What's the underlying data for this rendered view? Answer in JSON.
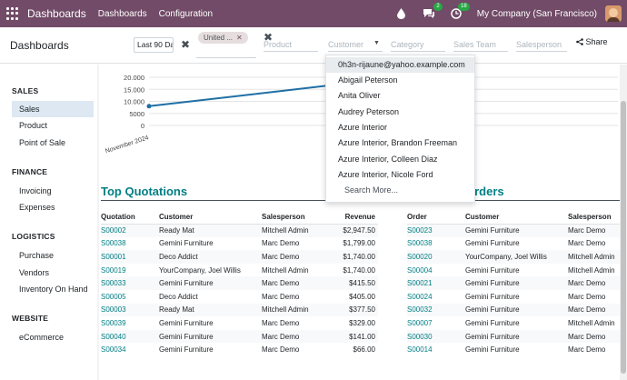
{
  "topbar": {
    "app_title": "Dashboards",
    "menu": [
      "Dashboards",
      "Configuration"
    ],
    "chat_badge": "2",
    "activity_badge": "18",
    "company": "My Company (San Francisco)",
    "colors": {
      "bar": "#714b67",
      "chat_badge": "#28a745",
      "activity_badge": "#28a745"
    }
  },
  "control": {
    "page_title": "Dashboards",
    "period": "Last 90 Days",
    "facet": "United ...",
    "fields": {
      "product": "Product",
      "customer": "Customer",
      "category": "Category",
      "sales_team": "Sales Team",
      "salesperson": "Salesperson"
    },
    "share_label": "Share"
  },
  "sidebar": {
    "sections": [
      {
        "title": "SALES",
        "items": [
          "Sales",
          "Product",
          "Point of Sale"
        ]
      },
      {
        "title": "FINANCE",
        "items": [
          "Invoicing",
          "Expenses"
        ]
      },
      {
        "title": "LOGISTICS",
        "items": [
          "Purchase",
          "Vendors",
          "Inventory On Hand"
        ]
      },
      {
        "title": "WEBSITE",
        "items": [
          "eCommerce"
        ]
      }
    ],
    "active_item": "Sales"
  },
  "chart_data": {
    "type": "line",
    "yticks": [
      "20.000",
      "15.000",
      "10.000",
      "5000",
      "0"
    ],
    "xticks": [
      "November 2024"
    ],
    "ylim": [
      0,
      20000
    ],
    "series": [
      {
        "x": [
          "November 2024",
          ""
        ],
        "values": [
          8000,
          16500
        ]
      }
    ],
    "line_color": "#1f6fa5"
  },
  "customer_dropdown": {
    "items": [
      "0h3n-rijaune@yahoo.example.com",
      "Abigail Peterson",
      "Anita Oliver",
      "Audrey Peterson",
      "Azure Interior",
      "Azure Interior, Brandon Freeman",
      "Azure Interior, Colleen Diaz",
      "Azure Interior, Nicole Ford"
    ],
    "more": "Search More..."
  },
  "top_quotations": {
    "title": "Top Quotations",
    "columns": [
      "Quotation",
      "Customer",
      "Salesperson",
      "Revenue"
    ],
    "rows": [
      [
        "S00002",
        "Ready Mat",
        "Mitchell Admin",
        "$2,947.50"
      ],
      [
        "S00038",
        "Gemini Furniture",
        "Marc Demo",
        "$1,799.00"
      ],
      [
        "S00001",
        "Deco Addict",
        "Marc Demo",
        "$1,740.00"
      ],
      [
        "S00019",
        "YourCompany, Joel Willis",
        "Mitchell Admin",
        "$1,740.00"
      ],
      [
        "S00033",
        "Gemini Furniture",
        "Marc Demo",
        "$415.50"
      ],
      [
        "S00005",
        "Deco Addict",
        "Marc Demo",
        "$405.00"
      ],
      [
        "S00003",
        "Ready Mat",
        "Mitchell Admin",
        "$377.50"
      ],
      [
        "S00039",
        "Gemini Furniture",
        "Marc Demo",
        "$329.00"
      ],
      [
        "S00040",
        "Gemini Furniture",
        "Marc Demo",
        "$141.00"
      ],
      [
        "S00034",
        "Gemini Furniture",
        "Marc Demo",
        "$66.00"
      ]
    ]
  },
  "top_orders": {
    "title": "Orders",
    "columns": [
      "Order",
      "Customer",
      "Salesperson"
    ],
    "rows": [
      [
        "S00023",
        "Gemini Furniture",
        "Marc Demo"
      ],
      [
        "S00038",
        "Gemini Furniture",
        "Marc Demo"
      ],
      [
        "S00020",
        "YourCompany, Joel Willis",
        "Mitchell Admin"
      ],
      [
        "S00004",
        "Gemini Furniture",
        "Mitchell Admin"
      ],
      [
        "S00021",
        "Gemini Furniture",
        "Marc Demo"
      ],
      [
        "S00024",
        "Gemini Furniture",
        "Marc Demo"
      ],
      [
        "S00032",
        "Gemini Furniture",
        "Marc Demo"
      ],
      [
        "S00007",
        "Gemini Furniture",
        "Mitchell Admin"
      ],
      [
        "S00030",
        "Gemini Furniture",
        "Marc Demo"
      ],
      [
        "S00014",
        "Gemini Furniture",
        "Marc Demo"
      ]
    ]
  }
}
